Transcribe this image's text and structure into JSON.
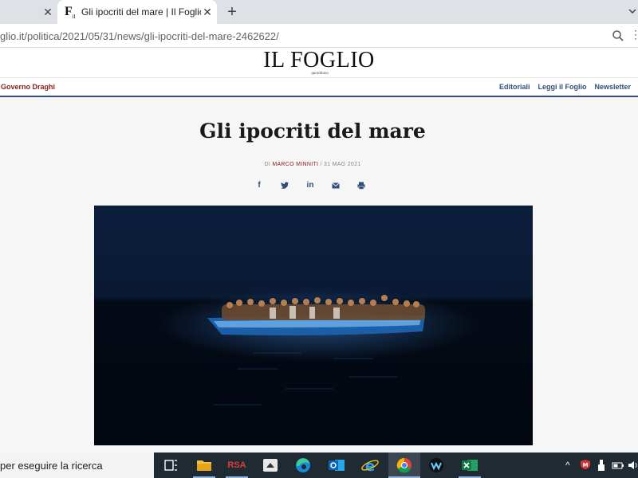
{
  "browser": {
    "tabs": [
      {
        "title": ""
      },
      {
        "title": "Gli ipocriti del mare | Il Foglio",
        "favicon": "F",
        "favicon_sub": "il"
      }
    ],
    "new_tab_label": "+",
    "close_glyph": "✕",
    "url": "glio.it/politica/2021/05/31/news/gli-ipocriti-del-mare-2462622/"
  },
  "site": {
    "logo": "IL FOGLIO",
    "logo_sub": "quotidiano",
    "nav_left": "Governo Draghi",
    "nav_right": [
      "Editoriali",
      "Leggi il Foglio",
      "Newsletter"
    ]
  },
  "article": {
    "headline": "Gli ipocriti del mare",
    "byline_prefix": "DI",
    "author": "MARCO MINNITI",
    "date": "/ 31 MAG 2021",
    "share": [
      "facebook-icon",
      "twitter-icon",
      "linkedin-icon",
      "mail-icon",
      "print-icon"
    ],
    "hero_description_icon": "photo"
  },
  "taskbar": {
    "search_text": "per eseguire la ricerca",
    "apps": [
      "task-view-icon",
      "file-explorer-icon",
      "rsa-icon",
      "app-icon",
      "edge-icon",
      "outlook-icon",
      "internet-explorer-icon",
      "chrome-icon",
      "webex-icon",
      "excel-icon"
    ],
    "rsa_label": "RSA"
  },
  "colors": {
    "accent_red": "#8a1c1c",
    "accent_blue": "#2f4f79",
    "taskbar": "#1f2a33"
  }
}
